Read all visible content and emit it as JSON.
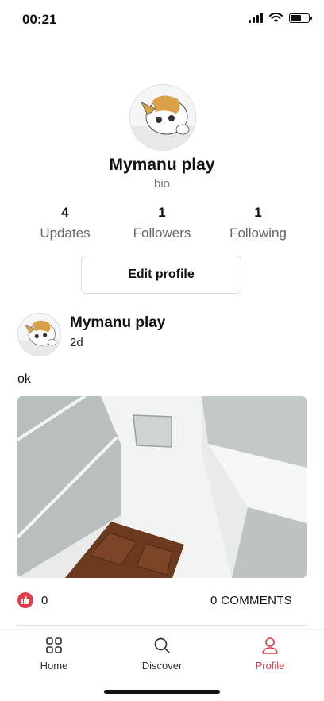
{
  "status": {
    "time": "00:21"
  },
  "profile": {
    "name": "Mymanu play",
    "bio": "bio",
    "stats": [
      {
        "value": "4",
        "label": "Updates"
      },
      {
        "value": "1",
        "label": "Followers"
      },
      {
        "value": "1",
        "label": "Following"
      }
    ],
    "edit_label": "Edit profile"
  },
  "post": {
    "author": "Mymanu play",
    "time": "2d",
    "text": "ok",
    "likes": "0",
    "comments_label": "0 COMMENTS"
  },
  "tabs": [
    {
      "label": "Home",
      "icon": "grid-icon"
    },
    {
      "label": "Discover",
      "icon": "search-icon"
    },
    {
      "label": "Profile",
      "icon": "user-icon",
      "active": true
    }
  ],
  "colors": {
    "accent": "#d9394a"
  }
}
